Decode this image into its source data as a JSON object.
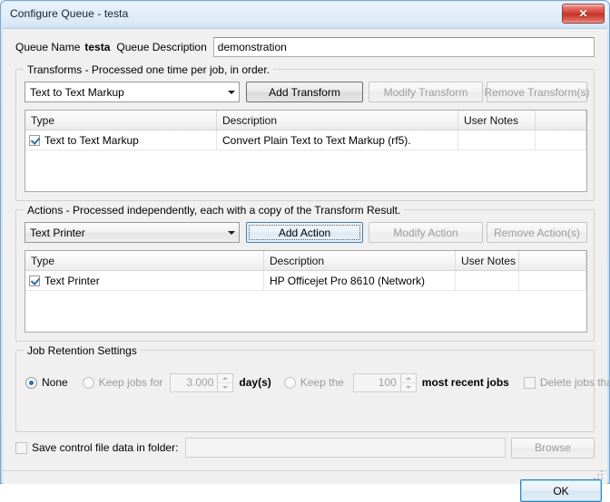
{
  "window": {
    "title": "Configure Queue - testa",
    "close_label": "✕"
  },
  "header": {
    "queue_name_label": "Queue Name",
    "queue_name_value": "testa",
    "queue_description_label": "Queue Description",
    "queue_description_value": "demonstration",
    "queue_description_placeholder": ""
  },
  "transforms": {
    "group_title": "Transforms - Processed one time per job, in order.",
    "combo_value": "Text to Text Markup",
    "add_label": "Add Transform",
    "modify_label": "Modify Transform",
    "remove_label": "Remove Transform(s)",
    "columns": [
      "Type",
      "Description",
      "User Notes",
      ""
    ],
    "rows": [
      {
        "checked": true,
        "type": "Text to Text Markup",
        "description": "Convert Plain Text to Text Markup (rf5).",
        "user_notes": "",
        "extra": ""
      }
    ]
  },
  "actions": {
    "group_title": "Actions - Processed independently, each with a copy of the Transform Result.",
    "combo_value": "Text Printer",
    "add_label": "Add Action",
    "modify_label": "Modify Action",
    "remove_label": "Remove Action(s)",
    "columns": [
      "Type",
      "Description",
      "User Notes",
      ""
    ],
    "rows": [
      {
        "checked": true,
        "type": "Text Printer",
        "description": "HP Officejet Pro 8610 (Network)",
        "user_notes": "",
        "extra": ""
      }
    ]
  },
  "retention": {
    "group_title": "Job Retention Settings",
    "none_label": "None",
    "keep_jobs_for_label": "Keep jobs for",
    "days_value": "3.000",
    "days_unit_label": "day(s)",
    "keep_the_label": "Keep the",
    "most_recent_value": "100",
    "most_recent_label": "most recent jobs",
    "delete_errors_label": "Delete jobs that error",
    "selected": "None"
  },
  "save_control": {
    "checkbox_label": "Save control file data in folder:",
    "folder_value": "",
    "folder_placeholder": "",
    "browse_label": "Browse"
  },
  "footer": {
    "ok_label": "OK"
  },
  "colors": {
    "dialog_background": "#f0f0f0",
    "title_bar": "#cfe2f4",
    "close_button": "#cf3b30",
    "accent_focus": "#3c7fb1",
    "default_button_border": "#2c86c6",
    "checkbox_check": "#2f6fa8",
    "radio_dot": "#2d6fa8",
    "disabled_text": "#9b9b9b"
  }
}
